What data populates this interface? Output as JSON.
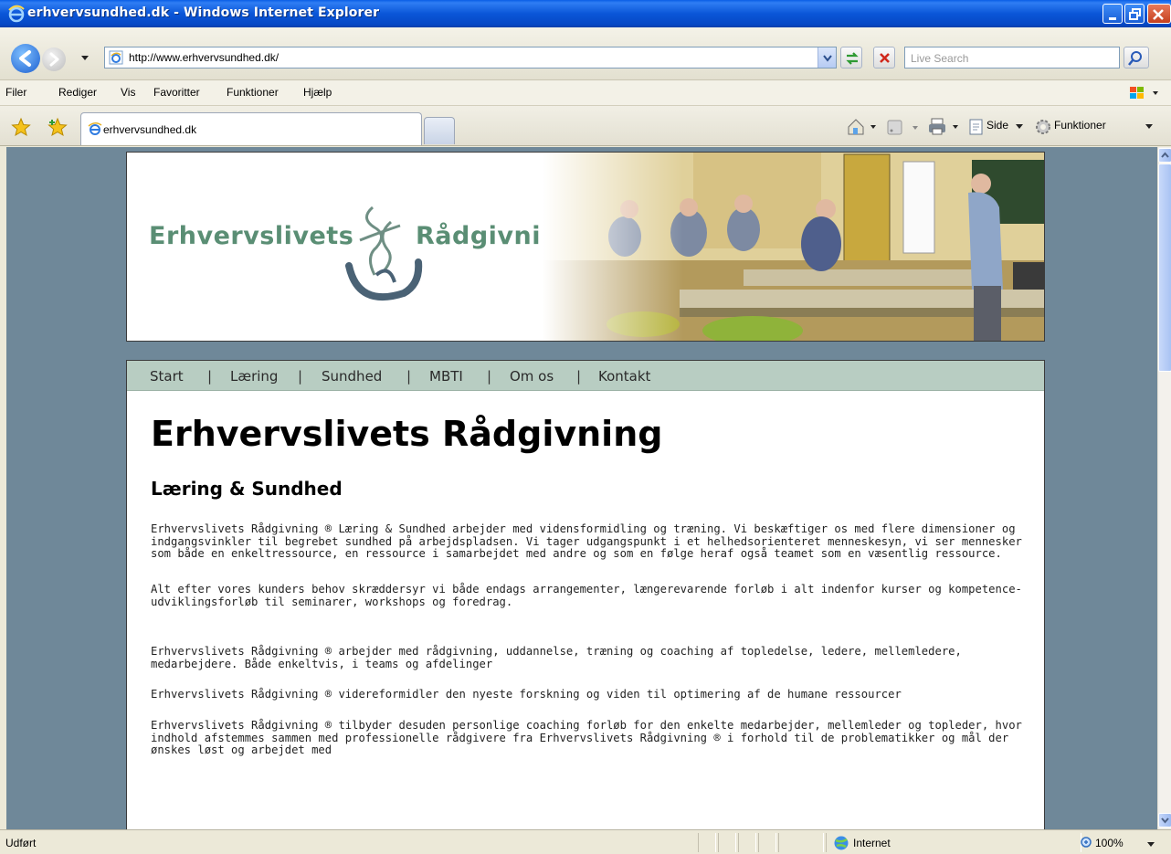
{
  "window": {
    "title": "erhvervsundhed.dk - Windows Internet Explorer"
  },
  "address_bar": {
    "url": "http://www.erhvervsundhed.dk/",
    "search_placeholder": "Live Search"
  },
  "menu": {
    "items": [
      {
        "label": "Filer",
        "underline": "F",
        "rest": "iler"
      },
      {
        "label": "Rediger",
        "underline": "R",
        "rest": "ediger"
      },
      {
        "label": "Vis",
        "underline": "s"
      },
      {
        "label": "Favoritter"
      },
      {
        "label": "Funktioner"
      },
      {
        "label": "Hjælp"
      }
    ]
  },
  "tabs": {
    "active_label": "erhvervsundhed.dk"
  },
  "command_bar": {
    "page_label": "Side",
    "tools_label": "Funktioner"
  },
  "banner": {
    "logo_left": "Erhvervslivets",
    "logo_right": "Rådgivning"
  },
  "site_nav": {
    "items": [
      "Start",
      "Læring",
      "Sundhed",
      "MBTI",
      "Om os",
      "Kontakt"
    ],
    "separator": "|"
  },
  "content": {
    "heading": "Erhvervslivets Rådgivning",
    "subheading": "Læring & Sundhed",
    "paragraphs": [
      "Erhvervslivets Rådgivning ® Læring & Sundhed arbejder med vidensformidling og træning. Vi beskæftiger os med flere dimensioner og indgangsvinkler til begrebet sundhed på arbejdspladsen. Vi tager udgangspunkt i et helhedsorienteret menneskesyn, vi ser mennesker som både en enkeltressource, en ressource i samarbejdet med andre og som en følge heraf også teamet som en væsentlig ressource.",
      "Alt efter vores kunders behov skræddersyr vi både endags arrangementer, længerevarende forløb i alt indenfor kurser og kompetence-udviklingsforløb til seminarer, workshops og foredrag.",
      "Erhvervslivets Rådgivning ® arbejder med rådgivning, uddannelse, træning og coaching af topledelse, ledere, mellemledere, medarbejdere. Både enkeltvis, i teams og afdelinger",
      "Erhvervslivets Rådgivning ® videreformidler den nyeste forskning og viden til optimering af de humane ressourcer",
      "Erhvervslivets Rådgivning ® tilbyder desuden personlige coaching forløb for den enkelte medarbejder, mellemleder og topleder, hvor indhold afstemmes sammen med professionelle rådgivere fra Erhvervslivets Rådgivning ® i forhold til de problematikker og mål der ønskes løst og arbejdet med"
    ]
  },
  "status_bar": {
    "status_text": "Udført",
    "zone": "Internet",
    "zoom": "100%"
  },
  "colors": {
    "page_background": "#6f8899",
    "nav_strip": "#b8cdc2",
    "logo_green": "#5a8e74",
    "titlebar_blue": "#0a56d8"
  }
}
